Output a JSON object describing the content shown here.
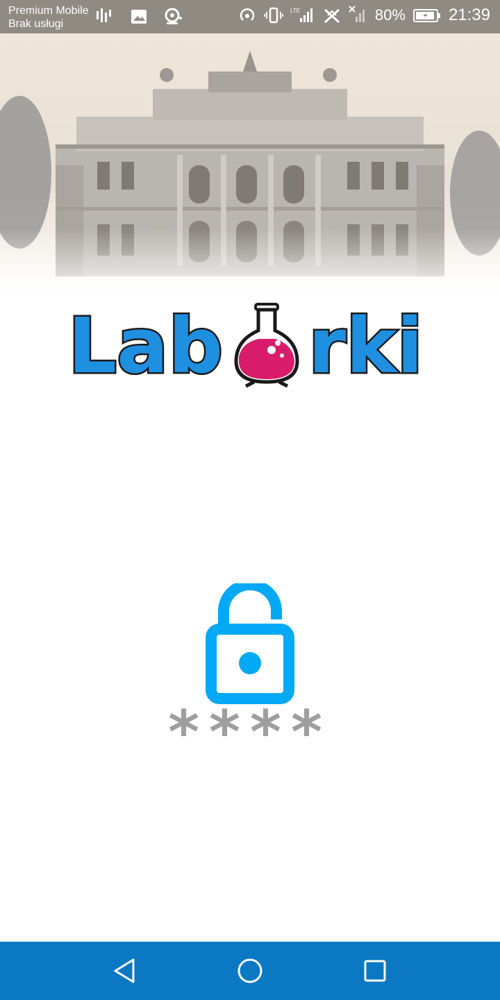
{
  "status_bar": {
    "carrier_line1": "Premium Mobile",
    "carrier_line2": "Brak usługi",
    "battery_percent": "80%",
    "time": "21:39",
    "icons": [
      "equalizer-icon",
      "image-icon",
      "sync-settings-icon",
      "hotspot-icon",
      "vibrate-icon",
      "lte-signal-icon",
      "no-data-icon",
      "no-signal-icon",
      "battery-charging-icon"
    ]
  },
  "logo": {
    "text_left": "Lab",
    "text_right": "rki",
    "flask_color": "#d81b6a",
    "letter_color": "#1f8fe0"
  },
  "lock": {
    "icon": "unlocked-padlock-icon",
    "color": "#03a9f4"
  },
  "pin": {
    "masked": "****"
  },
  "nav_bar": {
    "color": "#0a78c3",
    "buttons": [
      "back-icon",
      "home-icon",
      "recents-icon"
    ]
  }
}
